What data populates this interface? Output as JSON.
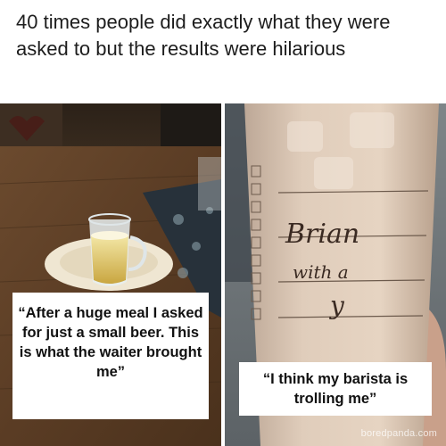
{
  "headline": "40 times people did exactly what they were asked to but the results were hilarious",
  "panels": {
    "left": {
      "caption": "“After a huge meal I asked for just a small beer. This is what the waiter brought me”"
    },
    "right": {
      "caption": "“I think my barista is trolling me”",
      "cup_writing_name": "Brian",
      "cup_writing_line2": "with a",
      "cup_writing_line3": "y",
      "watermark": "boredpanda.com"
    }
  }
}
